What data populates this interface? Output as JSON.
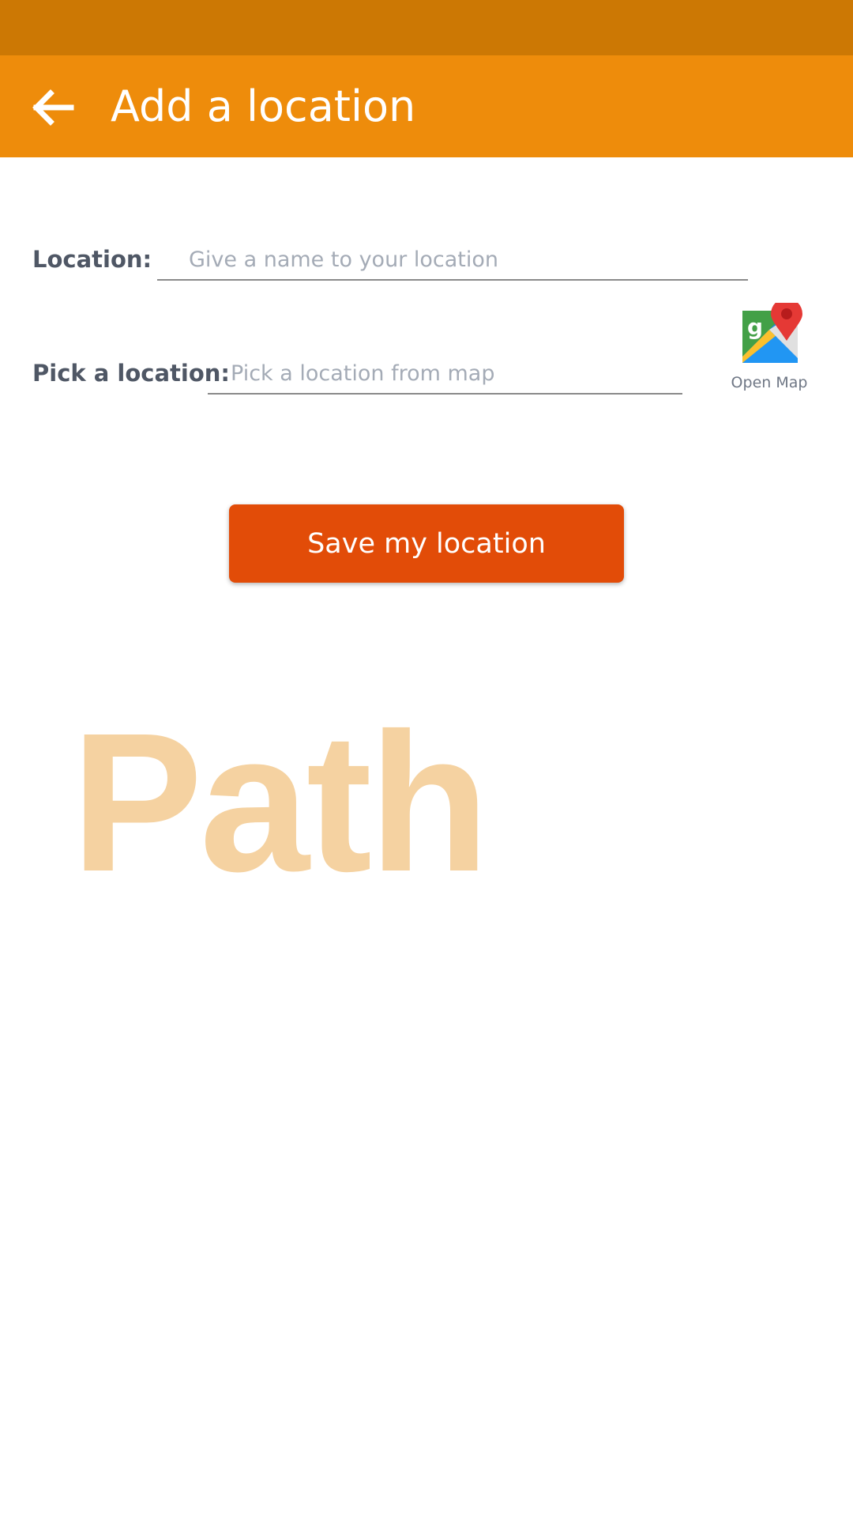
{
  "header": {
    "title": "Add a location",
    "back_icon": "arrow-left-icon"
  },
  "form": {
    "location_label": "Location:",
    "location_placeholder": "Give a name to your location",
    "location_value": "",
    "pick_label": "Pick a location:",
    "pick_placeholder": "Pick a location from map",
    "pick_value": ""
  },
  "map_button": {
    "icon": "google-maps-icon",
    "label": "Open Map"
  },
  "save_button": {
    "label": "Save my location"
  },
  "branding": {
    "watermark": "Path"
  },
  "colors": {
    "status_bar": "#cc7804",
    "app_bar": "#ee8c0b",
    "save_button": "#e24c08",
    "watermark": "#f5d2a1"
  }
}
